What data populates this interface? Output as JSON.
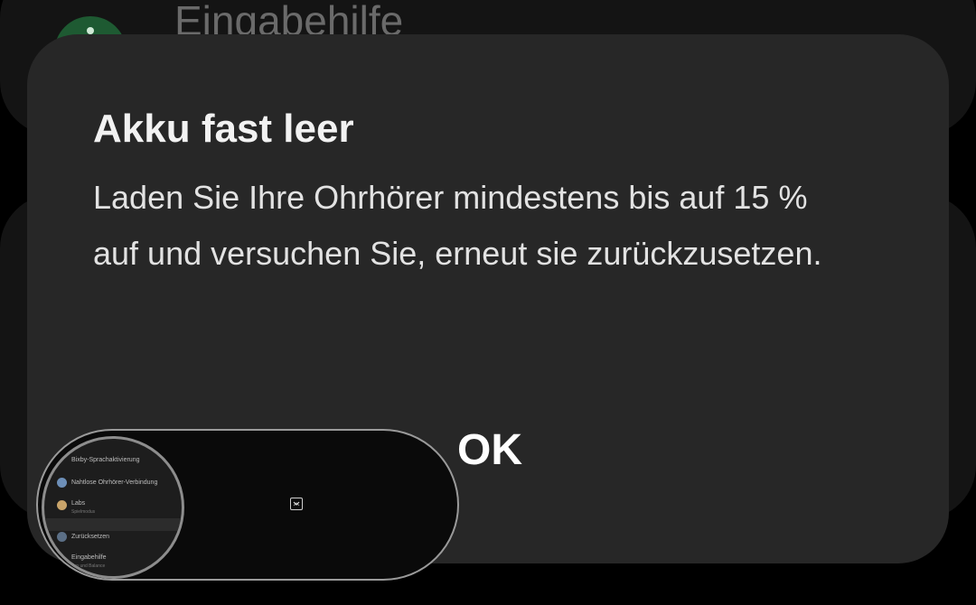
{
  "background": {
    "title": "Eingabehilfe"
  },
  "dialog": {
    "title": "Akku fast leer",
    "body": "Laden Sie Ihre Ohrhörer mindestens bis auf 15 % auf und versuchen Sie, erneut sie zurückzusetzen.",
    "ok_label": "OK"
  },
  "pip": {
    "items": [
      {
        "label": "Bixby-Sprachaktivierung",
        "icon": "none"
      },
      {
        "label": "Nahtlose Ohrhörer-Verbindung",
        "icon": "earbuds-icon"
      },
      {
        "label": "Labs",
        "sub": "Spielmodus",
        "icon": "labs-icon"
      },
      {
        "label": "Zurücksetzen",
        "icon": "reset-icon"
      },
      {
        "label": "Eingabehilfe",
        "sub": "Ton und Balance",
        "icon": "accessibility-icon"
      }
    ],
    "expand_icon": "expand-icon"
  },
  "colors": {
    "dialog_bg": "#272727",
    "page_bg": "#000000",
    "text": "#f2f2f2"
  }
}
